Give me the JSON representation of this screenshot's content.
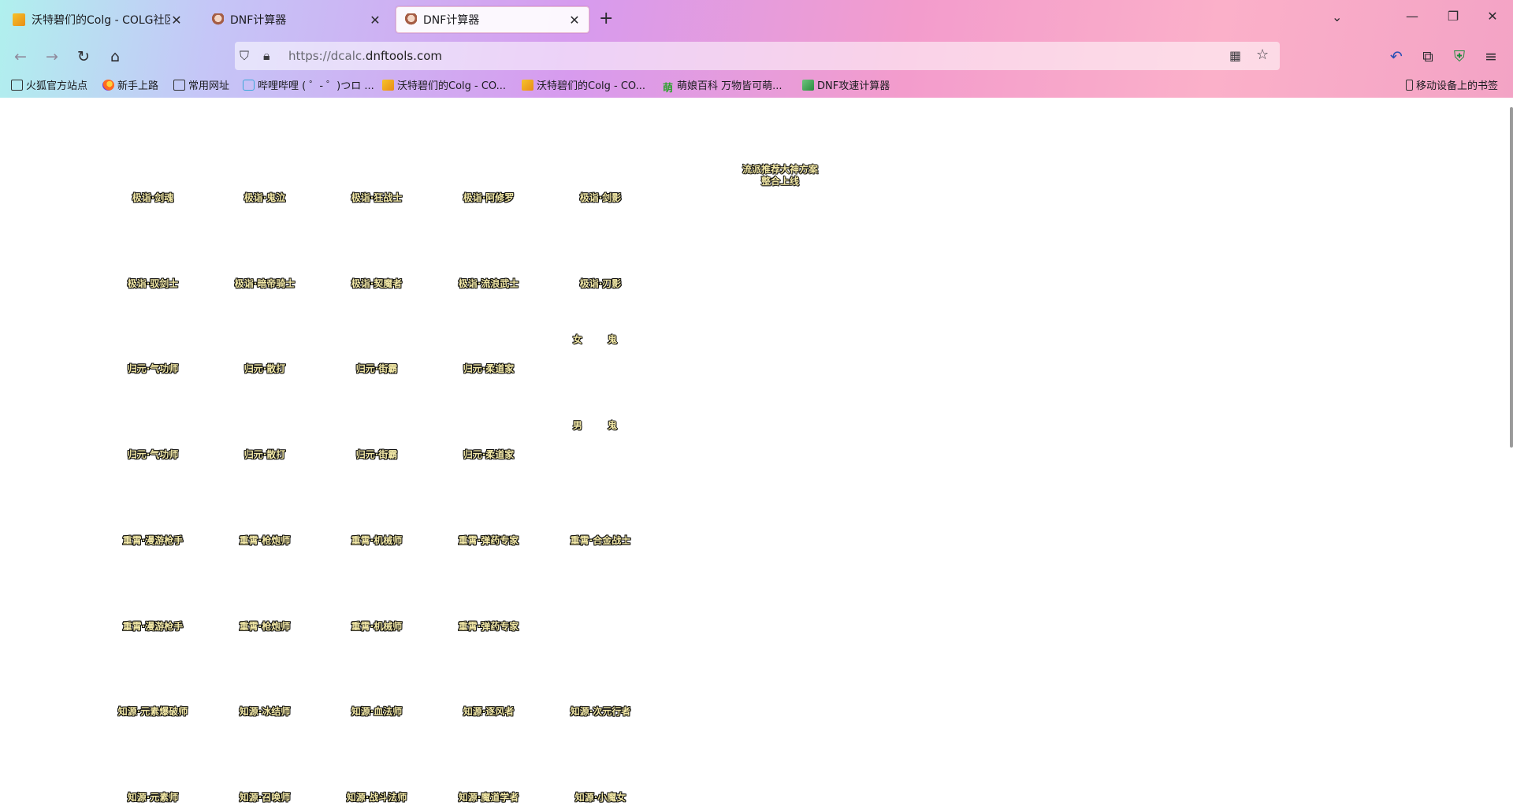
{
  "tabs": [
    {
      "title": "沃特碧们的Colg - COLG社区",
      "active": false,
      "favicon": "colg-icon"
    },
    {
      "title": "DNF计算器",
      "active": false,
      "favicon": "dnf-icon"
    },
    {
      "title": "DNF计算器",
      "active": true,
      "favicon": "dnf-icon"
    }
  ],
  "address": {
    "scheme": "https://dcalc.",
    "domain": "dnftools.com"
  },
  "bookmarks": [
    {
      "label": "火狐官方站点",
      "icon": "folder-icon"
    },
    {
      "label": "新手上路",
      "icon": "firefox-icon"
    },
    {
      "label": "常用网址",
      "icon": "folder-icon"
    },
    {
      "label": "哔哩哔哩 ( ゜- ゜)つロ ...",
      "icon": "bilibili-icon"
    },
    {
      "label": "沃特碧们的Colg - CO...",
      "icon": "colg-icon"
    },
    {
      "label": "沃特碧们的Colg - CO...",
      "icon": "colg-icon"
    },
    {
      "label": "萌娘百科 万物皆可萌...",
      "icon": "moegirl-icon"
    },
    {
      "label": "DNF攻速计算器",
      "icon": "dnf-calc-icon"
    }
  ],
  "bookmarks_right": "移动设备上的书签",
  "notice": {
    "line1": "流派推荐大神方案",
    "line2": "整合上线"
  },
  "gender_labels": {
    "female": "女 鬼",
    "male": "男 鬼"
  },
  "job_rows": [
    [
      "极诣·剑魂",
      "极诣·鬼泣",
      "极诣·狂战士",
      "极诣·阿修罗",
      "极诣·剑影"
    ],
    [
      "极诣·驭剑士",
      "极诣·暗帝骑士",
      "极诣·契魔者",
      "极诣·流浪武士",
      "极诣·刃影"
    ],
    [
      "归元·气功师",
      "归元·散打",
      "归元·街霸",
      "归元·柔道家"
    ],
    [
      "归元·气功师",
      "归元·散打",
      "归元·街霸",
      "归元·柔道家"
    ],
    [
      "重霄·漫游枪手",
      "重霄·枪炮师",
      "重霄·机械师",
      "重霄·弹药专家",
      "重霄·合金战士"
    ],
    [
      "重霄·漫游枪手",
      "重霄·枪炮师",
      "重霄·机械师",
      "重霄·弹药专家"
    ],
    [
      "知源·元素爆破师",
      "知源·冰结师",
      "知源·血法师",
      "知源·逐风者",
      "知源·次元行者"
    ],
    [
      "知源·元素师",
      "知源·召唤师",
      "知源·战斗法师",
      "知源·魔道学者",
      "知源·小魔女"
    ]
  ]
}
